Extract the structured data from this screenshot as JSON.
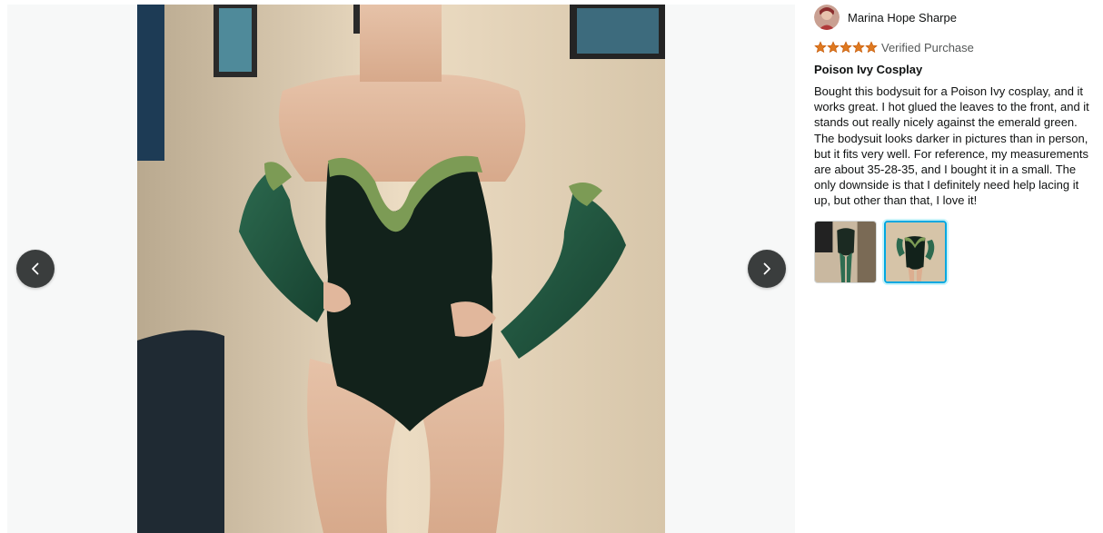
{
  "viewer": {
    "photo_alt": "customer-review-photo",
    "prev_label": "Previous image",
    "next_label": "Next image"
  },
  "review": {
    "author": "Marina Hope Sharpe",
    "rating": 5,
    "rating_max": 5,
    "verified": "Verified Purchase",
    "title": "Poison Ivy Cosplay",
    "body": "Bought this bodysuit for a Poison Ivy cosplay, and it works great. I hot glued the leaves to the front, and it stands out really nicely against the emerald green. The bodysuit looks darker in pictures than in person, but it fits very well. For reference, my measurements are about 35-28-35, and I bought it in a small. The only downside is that I definitely need help lacing it up, but other than that, I love it!",
    "thumbnails": [
      {
        "label": "thumbnail-1",
        "selected": false
      },
      {
        "label": "thumbnail-2",
        "selected": true
      }
    ]
  },
  "colors": {
    "star": "#de7921",
    "selected_border": "#00a8e1",
    "nav_button": "#3a3d3d"
  }
}
